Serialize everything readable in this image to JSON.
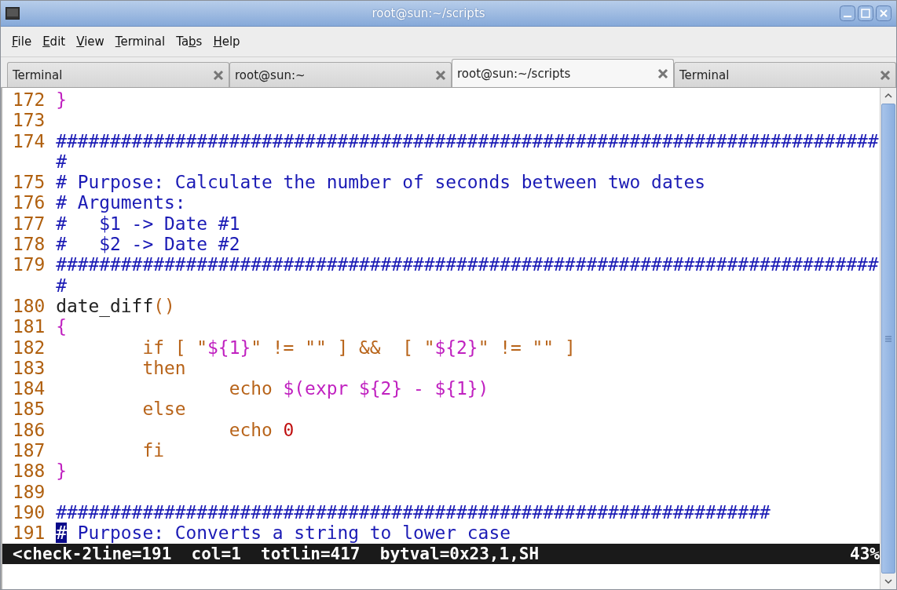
{
  "window": {
    "title": "root@sun:~/scripts"
  },
  "menu": [
    {
      "key": "F",
      "post": "ile"
    },
    {
      "key": "E",
      "post": "dit"
    },
    {
      "key": "V",
      "post": "iew"
    },
    {
      "key": "T",
      "post": "erminal"
    },
    {
      "pre": "Ta",
      "key": "b",
      "post": "s"
    },
    {
      "key": "H",
      "post": "elp"
    }
  ],
  "tabs": [
    {
      "label": "Terminal",
      "selected": false
    },
    {
      "label": "root@sun:~",
      "selected": false
    },
    {
      "label": "root@sun:~/scripts",
      "selected": true
    },
    {
      "label": "Terminal",
      "selected": false
    }
  ],
  "editor": {
    "lines": [
      {
        "number": "172",
        "segments": [
          {
            "kind": "special",
            "text": "}"
          }
        ]
      },
      {
        "number": "173"
      },
      {
        "number": "174",
        "segments": [
          {
            "kind": "comment",
            "text": "############################################################################"
          }
        ]
      },
      {
        "segments": [
          {
            "kind": "comment",
            "text": "#"
          }
        ]
      },
      {
        "number": "175",
        "segments": [
          {
            "kind": "comment",
            "text": "# Purpose: Calculate the number of seconds between two dates"
          }
        ]
      },
      {
        "number": "176",
        "segments": [
          {
            "kind": "comment",
            "text": "# Arguments:"
          }
        ]
      },
      {
        "number": "177",
        "segments": [
          {
            "kind": "comment",
            "text": "#   $1 -> Date #1"
          }
        ]
      },
      {
        "number": "178",
        "segments": [
          {
            "kind": "comment",
            "text": "#   $2 -> Date #2"
          }
        ]
      },
      {
        "number": "179",
        "segments": [
          {
            "kind": "comment",
            "text": "############################################################################"
          }
        ]
      },
      {
        "segments": [
          {
            "kind": "comment",
            "text": "#"
          }
        ]
      },
      {
        "number": "180",
        "segments": [
          {
            "kind": "plain",
            "text": "date_diff"
          },
          {
            "kind": "keyword",
            "text": "()"
          }
        ]
      },
      {
        "number": "181",
        "segments": [
          {
            "kind": "special",
            "text": "{"
          }
        ]
      },
      {
        "number": "182",
        "segments": [
          {
            "kind": "keyword",
            "text": "        if [ \""
          },
          {
            "kind": "special",
            "text": "${1}"
          },
          {
            "kind": "keyword",
            "text": "\" != \"\" ] &&  [ \""
          },
          {
            "kind": "special",
            "text": "${2}"
          },
          {
            "kind": "keyword",
            "text": "\" != \"\" ]"
          }
        ]
      },
      {
        "number": "183",
        "segments": [
          {
            "kind": "keyword",
            "text": "        then"
          }
        ]
      },
      {
        "number": "184",
        "segments": [
          {
            "kind": "keyword",
            "text": "                echo "
          },
          {
            "kind": "special",
            "text": "$(expr ${2} - ${1})"
          }
        ]
      },
      {
        "number": "185",
        "segments": [
          {
            "kind": "keyword",
            "text": "        else"
          }
        ]
      },
      {
        "number": "186",
        "segments": [
          {
            "kind": "keyword",
            "text": "                echo "
          },
          {
            "kind": "number",
            "text": "0"
          }
        ]
      },
      {
        "number": "187",
        "segments": [
          {
            "kind": "keyword",
            "text": "        fi"
          }
        ]
      },
      {
        "number": "188",
        "segments": [
          {
            "kind": "special",
            "text": "}"
          }
        ]
      },
      {
        "number": "189"
      },
      {
        "number": "190",
        "segments": [
          {
            "kind": "comment",
            "text": "##################################################################"
          }
        ]
      },
      {
        "number": "191",
        "segments": [
          {
            "kind": "cursor",
            "text": "#"
          },
          {
            "kind": "comment",
            "text": " Purpose: Converts a string to lower case"
          }
        ]
      }
    ]
  },
  "status_line": {
    "text": "<check-2line=191  col=1  totlin=417  bytval=0x23,1,SH",
    "percent": "43%"
  }
}
